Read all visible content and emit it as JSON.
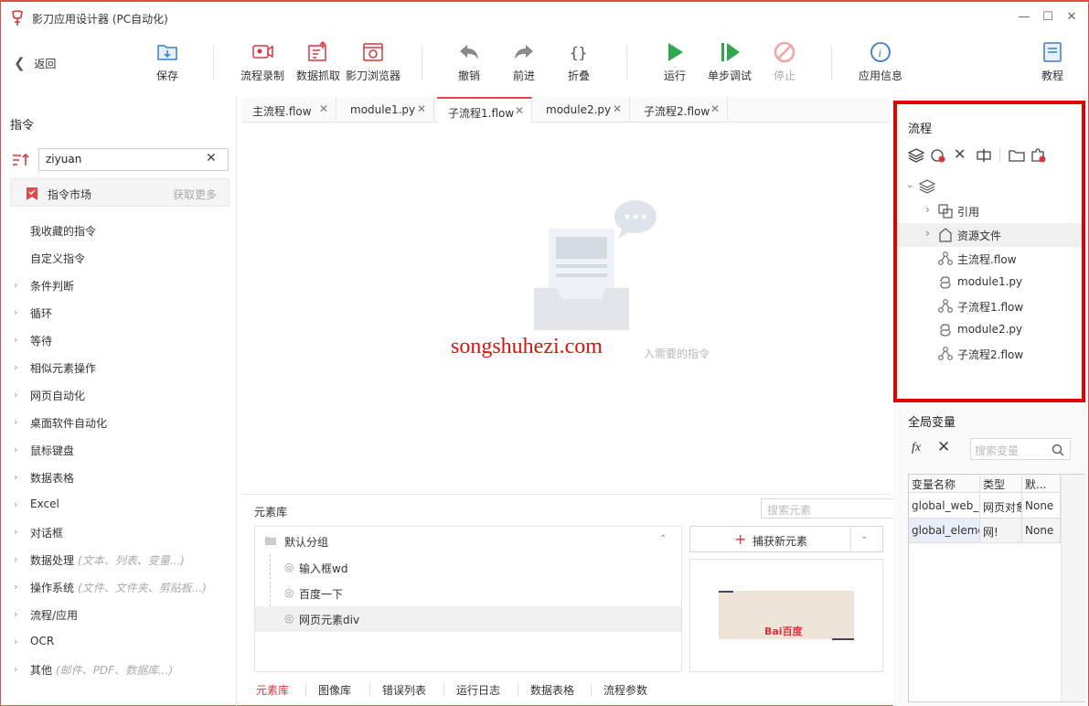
{
  "window": {
    "title": "影刀应用设计器 (PC自动化)"
  },
  "toolbar": {
    "back": "返回",
    "save": "保存",
    "record": "流程录制",
    "capture_data": "数据抓取",
    "browser": "影刀浏览器",
    "undo": "撤销",
    "redo": "前进",
    "fold": "折叠",
    "run": "运行",
    "step_debug": "单步调试",
    "stop": "停止",
    "app_info": "应用信息",
    "tutorial": "教程"
  },
  "left": {
    "title": "指令",
    "search_value": "ziyuan",
    "market_label": "指令市场",
    "market_more": "获取更多",
    "commands": [
      {
        "label": "我收藏的指令",
        "hint": ""
      },
      {
        "label": "自定义指令",
        "hint": ""
      },
      {
        "label": "条件判断",
        "hint": ""
      },
      {
        "label": "循环",
        "hint": ""
      },
      {
        "label": "等待",
        "hint": ""
      },
      {
        "label": "相似元素操作",
        "hint": ""
      },
      {
        "label": "网页自动化",
        "hint": ""
      },
      {
        "label": "桌面软件自动化",
        "hint": ""
      },
      {
        "label": "鼠标键盘",
        "hint": ""
      },
      {
        "label": "数据表格",
        "hint": ""
      },
      {
        "label": "Excel",
        "hint": ""
      },
      {
        "label": "对话框",
        "hint": ""
      },
      {
        "label": "数据处理",
        "hint": "(文本、列表、变量...)"
      },
      {
        "label": "操作系统",
        "hint": "(文件、文件夹、剪贴板...)"
      },
      {
        "label": "流程/应用",
        "hint": ""
      },
      {
        "label": "OCR",
        "hint": ""
      },
      {
        "label": "其他",
        "hint": "(邮件、PDF、数据库...)"
      }
    ]
  },
  "tabs": [
    {
      "label": "主流程.flow"
    },
    {
      "label": "module1.py"
    },
    {
      "label": "子流程1.flow"
    },
    {
      "label": "module2.py"
    },
    {
      "label": "子流程2.flow"
    }
  ],
  "canvas": {
    "empty_hint": "入需要的指令",
    "watermark": "songshuhezi.com"
  },
  "element_library": {
    "title": "元素库",
    "search_placeholder": "搜索元素",
    "group": "默认分组",
    "items": [
      "输入框wd",
      "百度一下",
      "网页元素div"
    ],
    "capture_button": "捕获新元素",
    "preview_logo": "Bai百度",
    "bottom_tabs": [
      "元素库",
      "图像库",
      "错误列表",
      "运行日志",
      "数据表格",
      "流程参数"
    ]
  },
  "flow_panel": {
    "title": "流程",
    "items": [
      {
        "label": "引用",
        "icon": "reference-icon"
      },
      {
        "label": "资源文件",
        "icon": "resource-icon"
      },
      {
        "label": "主流程.flow",
        "icon": "flow-icon"
      },
      {
        "label": "module1.py",
        "icon": "python-icon"
      },
      {
        "label": "子流程1.flow",
        "icon": "flow-icon"
      },
      {
        "label": "module2.py",
        "icon": "python-icon"
      },
      {
        "label": "子流程2.flow",
        "icon": "flow-icon"
      }
    ]
  },
  "globals": {
    "title": "全局变量",
    "search_placeholder": "搜索变量",
    "headers": [
      "变量名称",
      "类型",
      "默..."
    ],
    "rows": [
      [
        "global_web_p",
        "网页对象",
        "None"
      ],
      [
        "global_eleme",
        "网!",
        "None"
      ]
    ]
  },
  "colors": {
    "accent": "#e24a4a",
    "highlight_box": "#e50000",
    "run_green": "#2fa84f"
  }
}
